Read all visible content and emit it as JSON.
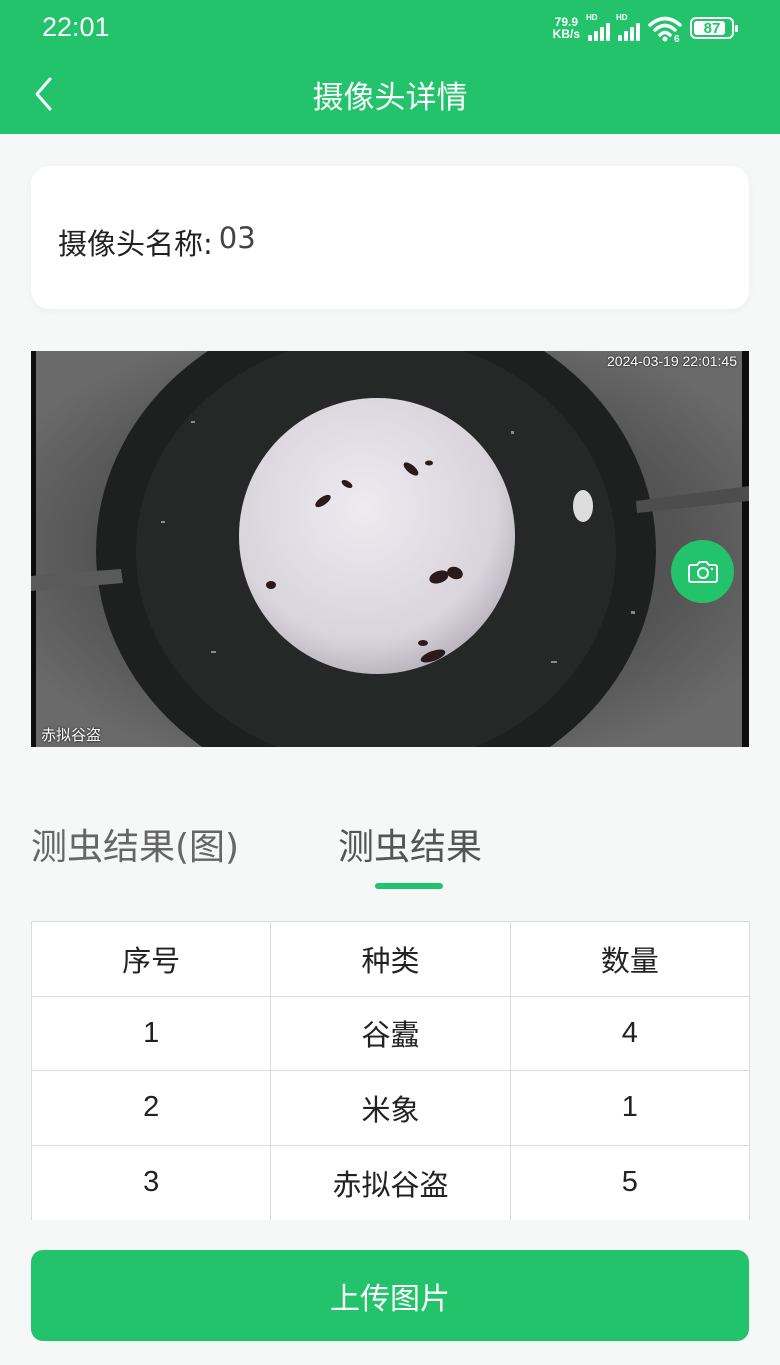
{
  "status_bar": {
    "time": "22:01",
    "net_speed_value": "79.9",
    "net_speed_unit": "KB/s",
    "signal1_label": "HD",
    "signal2_label": "HD",
    "wifi_badge": "6",
    "battery_percent": 87,
    "battery_label": "87"
  },
  "header": {
    "title": "摄像头详情",
    "back_icon": "chevron-left-icon"
  },
  "camera_info": {
    "name_label": "摄像头名称:",
    "name_value": "03"
  },
  "camera_view": {
    "timestamp": "2024-03-19 22:01:45",
    "overlay_label": "赤拟谷盗",
    "snapshot_icon": "camera-icon"
  },
  "tabs": [
    {
      "label": "测虫结果(图)",
      "active": false
    },
    {
      "label": "测虫结果",
      "active": true
    }
  ],
  "results": {
    "columns": [
      "序号",
      "种类",
      "数量"
    ],
    "rows": [
      [
        "1",
        "谷蠹",
        "4"
      ],
      [
        "2",
        "米象",
        "1"
      ],
      [
        "3",
        "赤拟谷盗",
        "5"
      ]
    ]
  },
  "actions": {
    "upload_label": "上传图片"
  },
  "colors": {
    "primary": "#22c36b",
    "background": "#f6f7f7"
  }
}
